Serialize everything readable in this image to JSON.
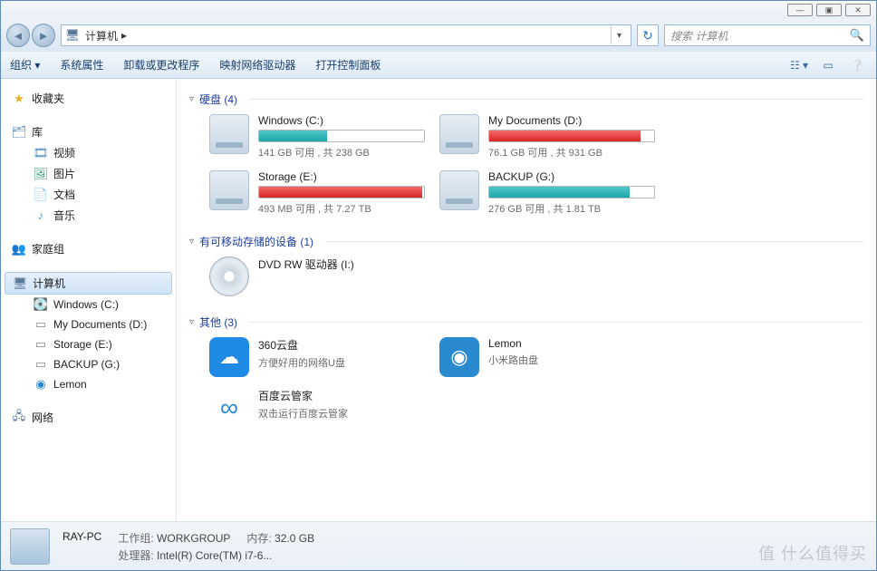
{
  "window": {
    "min": "—",
    "max": "▣",
    "close": "✕"
  },
  "nav": {
    "breadcrumb_root": "计算机",
    "search_placeholder": "搜索 计算机"
  },
  "toolbar": {
    "organize": "组织 ▾",
    "sys_props": "系统属性",
    "uninstall": "卸载或更改程序",
    "map_drive": "映射网络驱动器",
    "ctrl_panel": "打开控制面板"
  },
  "sidebar": {
    "favorites": "收藏夹",
    "library": "库",
    "video": "视频",
    "pictures": "图片",
    "documents": "文档",
    "music": "音乐",
    "homegroup": "家庭组",
    "computer": "计算机",
    "drive_c": "Windows (C:)",
    "drive_d": "My Documents (D:)",
    "drive_e": "Storage (E:)",
    "drive_g": "BACKUP (G:)",
    "lemon": "Lemon",
    "network": "网络"
  },
  "sections": {
    "hdd": "硬盘 (4)",
    "removable": "有可移动存储的设备 (1)",
    "other": "其他 (3)"
  },
  "drives": {
    "c": {
      "name": "Windows (C:)",
      "sub": "141 GB 可用 , 共 238 GB",
      "fill": 41,
      "color": "bar-teal"
    },
    "d": {
      "name": "My Documents (D:)",
      "sub": "76.1 GB 可用 , 共 931 GB",
      "fill": 92,
      "color": "bar-red"
    },
    "e": {
      "name": "Storage (E:)",
      "sub": "493 MB 可用 , 共 7.27 TB",
      "fill": 99,
      "color": "bar-red"
    },
    "g": {
      "name": "BACKUP (G:)",
      "sub": "276 GB 可用 , 共 1.81 TB",
      "fill": 85,
      "color": "bar-teal"
    },
    "dvd": {
      "name": "DVD RW 驱动器 (I:)"
    },
    "360": {
      "name": "360云盘",
      "sub": "方便好用的网络U盘"
    },
    "lemon": {
      "name": "Lemon",
      "sub": "小米路由盘"
    },
    "baidu": {
      "name": "百度云管家",
      "sub": "双击运行百度云管家"
    }
  },
  "status": {
    "name": "RAY-PC",
    "workgroup_lbl": "工作组:",
    "workgroup": "WORKGROUP",
    "mem_lbl": "内存:",
    "mem": "32.0 GB",
    "cpu_lbl": "处理器:",
    "cpu": "Intel(R) Core(TM) i7-6..."
  },
  "watermark": "值 什么值得买"
}
